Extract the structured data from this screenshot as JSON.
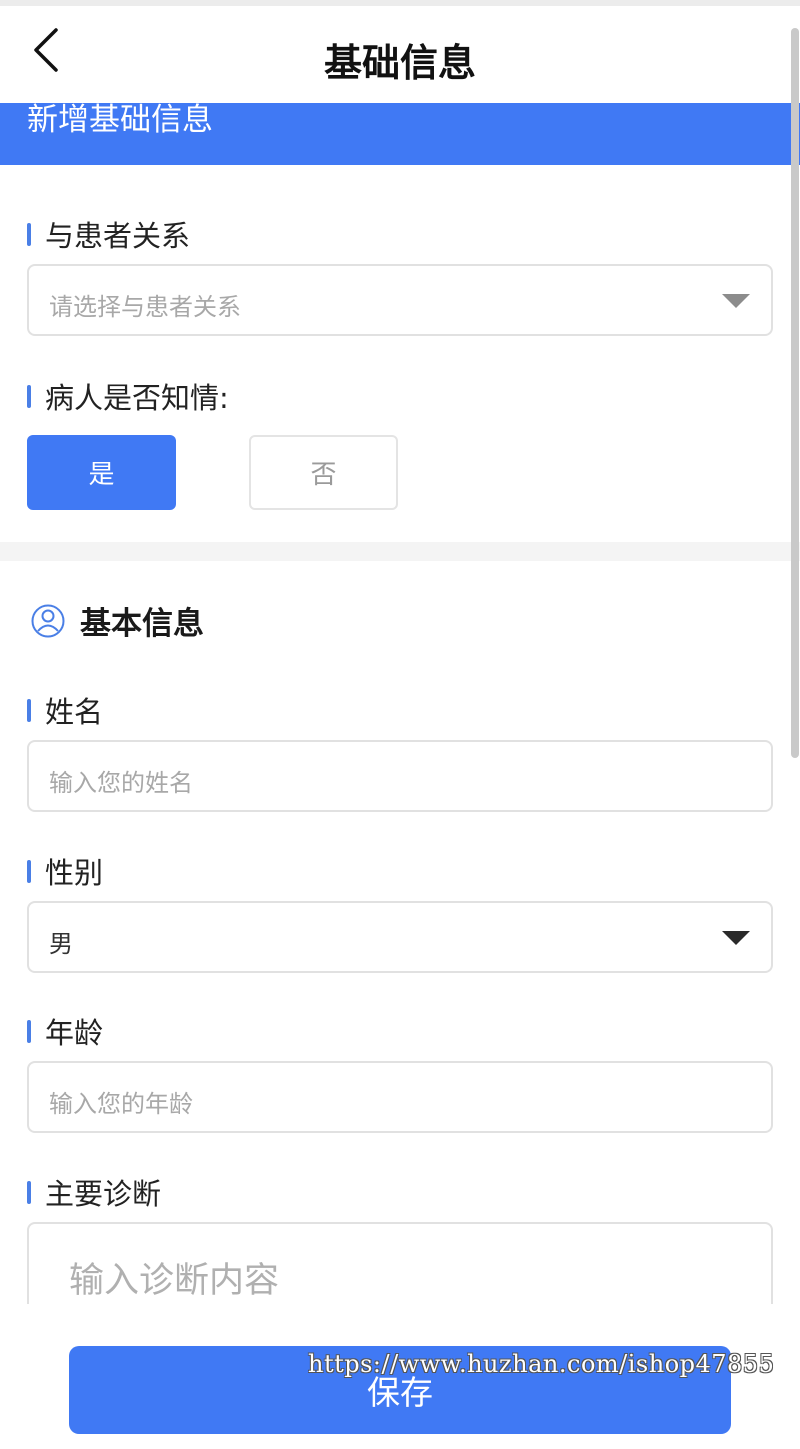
{
  "header": {
    "title": "基础信息"
  },
  "banner": {
    "text": "新增基础信息"
  },
  "relation": {
    "label": "与患者关系",
    "placeholder": "请选择与患者关系"
  },
  "informed": {
    "label": "病人是否知情:",
    "options": [
      "是",
      "否"
    ],
    "selected": "是"
  },
  "basic_info": {
    "title": "基本信息",
    "name": {
      "label": "姓名",
      "placeholder": "输入您的姓名"
    },
    "gender": {
      "label": "性别",
      "value": "男"
    },
    "age": {
      "label": "年龄",
      "placeholder": "输入您的年龄"
    },
    "diagnosis": {
      "label": "主要诊断",
      "placeholder": "输入诊断内容"
    }
  },
  "footer": {
    "save_label": "保存"
  },
  "watermark": "https://www.huzhan.com/ishop47855",
  "colors": {
    "primary": "#4079f4",
    "accent_bar": "#4a7fe6"
  }
}
